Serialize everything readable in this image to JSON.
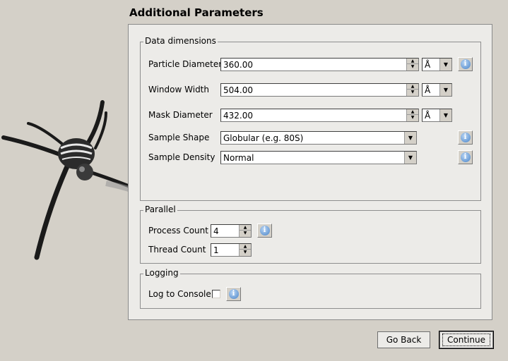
{
  "page": {
    "title": "Additional Parameters"
  },
  "data_dimensions": {
    "legend": "Data dimensions",
    "particle_diameter": {
      "label": "Particle Diameter",
      "value": "360.00",
      "unit": "Å"
    },
    "window_width": {
      "label": "Window Width",
      "value": "504.00",
      "unit": "Å"
    },
    "mask_diameter": {
      "label": "Mask Diameter",
      "value": "432.00",
      "unit": "Å"
    },
    "sample_shape": {
      "label": "Sample Shape",
      "value": "Globular (e.g. 80S)"
    },
    "sample_density": {
      "label": "Sample Density",
      "value": "Normal"
    }
  },
  "parallel": {
    "legend": "Parallel",
    "process_count": {
      "label": "Process Count",
      "value": "4"
    },
    "thread_count": {
      "label": "Thread Count",
      "value": "1"
    }
  },
  "logging": {
    "legend": "Logging",
    "log_to_console": {
      "label": "Log to Console",
      "checked": false
    }
  },
  "buttons": {
    "back": "Go Back",
    "continue": "Continue"
  },
  "icons": {
    "info": "info-icon",
    "spin_up": "spin-up-icon",
    "spin_down": "spin-down-icon",
    "dropdown": "dropdown-arrow-icon"
  },
  "glyphs": {
    "info": "i",
    "up": "▲",
    "down": "▼"
  }
}
